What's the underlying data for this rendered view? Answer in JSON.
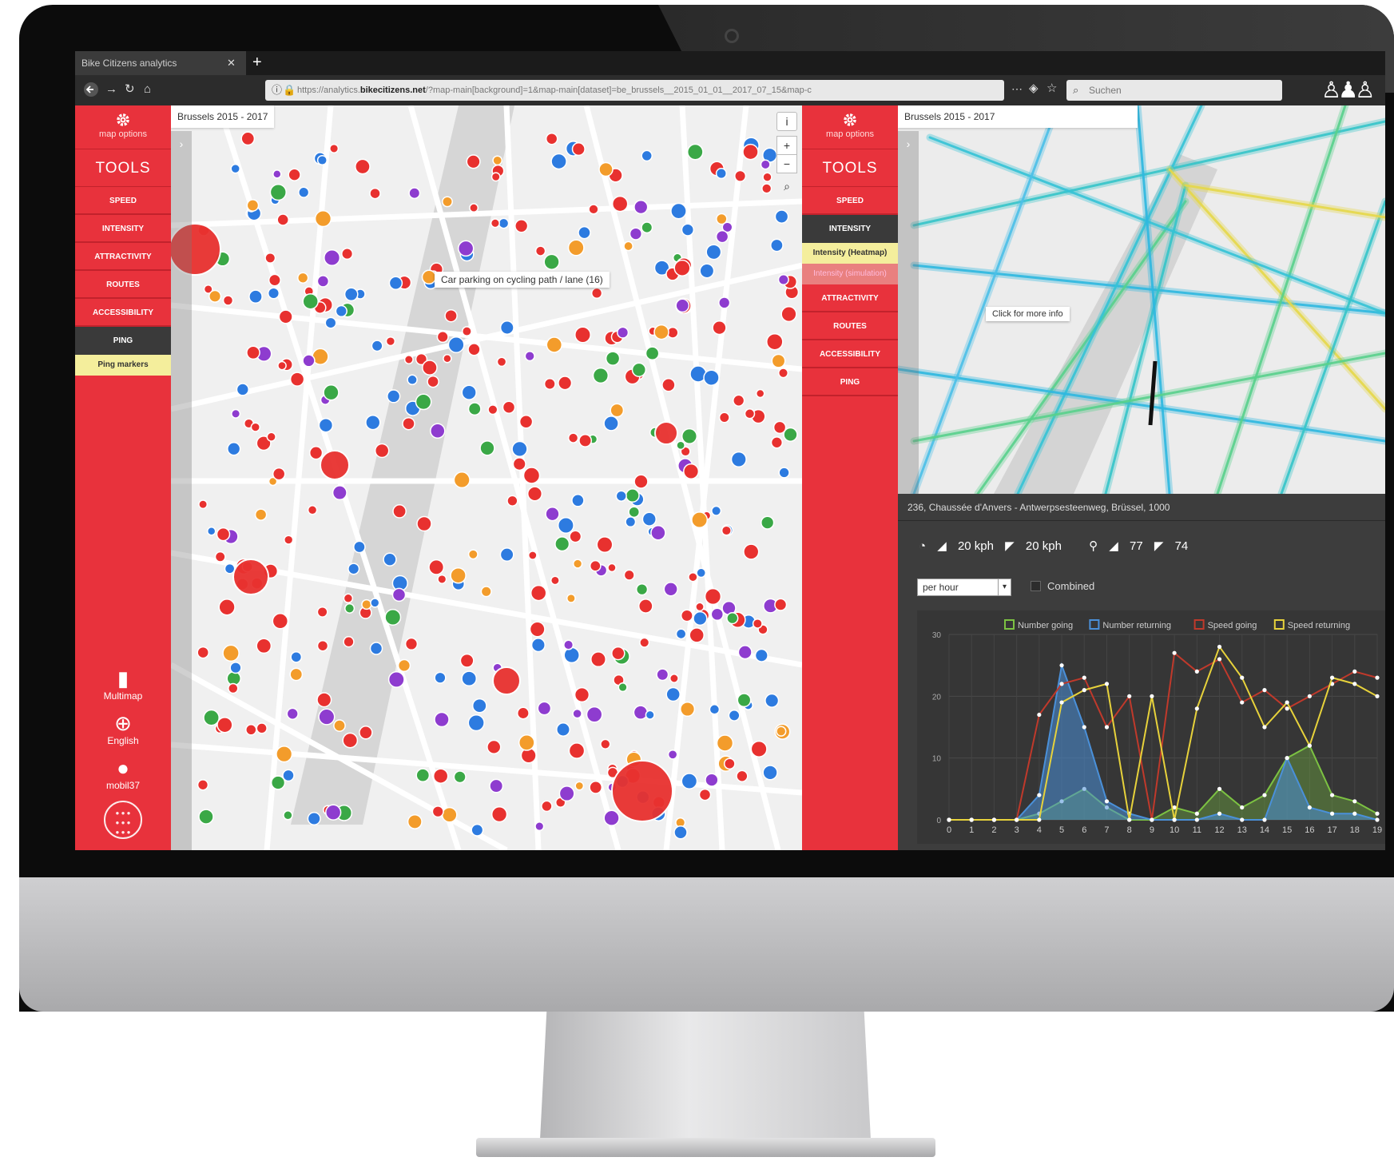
{
  "browser": {
    "tab_title": "Bike Citizens analytics",
    "tab_close": "✕",
    "new_tab": "+",
    "url_prefix": "https://analytics.",
    "url_domain": "bikecitizens.net",
    "url_rest": "/?map-main[background]=1&map-main[dataset]=be_brussels__2015_01_01__2017_07_15&map-c",
    "search_placeholder": "Suchen",
    "back_icon": "arrow-left",
    "forward_icon": "arrow-right",
    "reload_icon": "reload",
    "home_icon": "home"
  },
  "left_sidebar": {
    "map_options": "map options",
    "tools": "TOOLS",
    "items": [
      "SPEED",
      "INTENSITY",
      "ATTRACTIVITY",
      "ROUTES",
      "ACCESSIBILITY"
    ],
    "active_item": "PING",
    "active_sub": "Ping markers",
    "multimap": "Multimap",
    "language": "English",
    "user": "mobil37"
  },
  "right_sidebar": {
    "map_options": "map options",
    "tools": "TOOLS",
    "item_speed": "SPEED",
    "active_item": "INTENSITY",
    "active_sub": "Intensity (Heatmap)",
    "dim_sub": "Intensity (simulation)",
    "items_after": [
      "ATTRACTIVITY",
      "ROUTES",
      "ACCESSIBILITY",
      "PING"
    ]
  },
  "map_left": {
    "title": "Brussels 2015 - 2017",
    "tooltip": "Car parking on cycling path / lane (16)",
    "info_btn": "i",
    "zoom_in": "+",
    "zoom_out": "−",
    "ping_colors": {
      "red": "#e8312f",
      "blue": "#2d7be0",
      "green": "#3aa846",
      "purple": "#8e3ccf",
      "orange": "#f39c2b"
    }
  },
  "map_right": {
    "title": "Brussels 2015 - 2017",
    "tooltip": "Click for more info"
  },
  "detail_panel": {
    "address": "236, Chaussée d'Anvers - Antwerpsesteenweg, Brüssel, 1000",
    "speed_up": "20 kph",
    "speed_down": "20 kph",
    "count_up": "77",
    "count_down": "74",
    "period_select": "per hour",
    "combined_label": "Combined"
  },
  "chart_data": {
    "type": "line",
    "x": [
      0,
      1,
      2,
      3,
      4,
      5,
      6,
      7,
      8,
      9,
      10,
      11,
      12,
      13,
      14,
      15,
      16,
      17,
      18,
      19
    ],
    "ylim": [
      0,
      30
    ],
    "yticks": [
      0,
      10,
      20,
      30
    ],
    "legend_position": "top",
    "series": [
      {
        "name": "Number going",
        "color": "#7cc242",
        "values": [
          0,
          0,
          0,
          0,
          1,
          3,
          5,
          2,
          0,
          0,
          2,
          1,
          5,
          2,
          4,
          10,
          12,
          4,
          3,
          1
        ]
      },
      {
        "name": "Number returning",
        "color": "#4a90d9",
        "values": [
          0,
          0,
          0,
          0,
          4,
          25,
          15,
          3,
          1,
          0,
          0,
          0,
          1,
          0,
          0,
          10,
          2,
          1,
          1,
          0
        ]
      },
      {
        "name": "Speed going",
        "color": "#c0392b",
        "values": [
          0,
          0,
          0,
          0,
          17,
          22,
          23,
          15,
          20,
          0,
          27,
          24,
          26,
          19,
          21,
          18,
          20,
          22,
          24,
          23
        ]
      },
      {
        "name": "Speed returning",
        "color": "#e7d23b",
        "values": [
          0,
          0,
          0,
          0,
          0,
          19,
          21,
          22,
          0,
          20,
          0,
          18,
          28,
          23,
          15,
          19,
          12,
          23,
          22,
          20
        ]
      }
    ]
  }
}
